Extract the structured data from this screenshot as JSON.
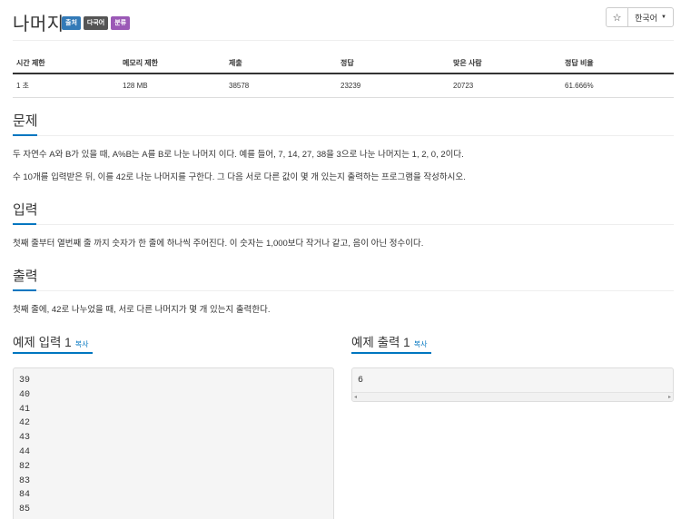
{
  "header": {
    "title": "나머지",
    "labels": [
      "출처",
      "다국어",
      "분류"
    ],
    "star_icon": "star-icon",
    "lang_label": "한국어"
  },
  "stats": {
    "headers": [
      "시간 제한",
      "메모리 제한",
      "제출",
      "정답",
      "맞은 사람",
      "정답 비율"
    ],
    "values": [
      "1 초",
      "128 MB",
      "38578",
      "23239",
      "20723",
      "61.666%"
    ]
  },
  "problem": {
    "heading": "문제",
    "p1": "두 자연수 A와 B가 있을 때, A%B는 A를 B로 나눈 나머지 이다. 예를 들어, 7, 14, 27, 38을 3으로 나눈 나머지는 1, 2, 0, 2이다.",
    "p2": "수 10개를 입력받은 뒤, 이를 42로 나눈 나머지를 구한다. 그 다음 서로 다른 값이 몇 개 있는지 출력하는 프로그램을 작성하시오."
  },
  "input": {
    "heading": "입력",
    "text": "첫째 줄부터 열번째 줄 까지 숫자가 한 줄에 하나씩 주어진다. 이 숫자는 1,000보다 작거나 같고, 음이 아닌 정수이다."
  },
  "output": {
    "heading": "출력",
    "text": "첫째 줄에, 42로 나누었을 때, 서로 다른 나머지가 몇 개 있는지 출력한다."
  },
  "sample_input": {
    "heading": "예제 입력 1",
    "copy": "복사",
    "lines": [
      "39",
      "40",
      "41",
      "42",
      "43",
      "44",
      "82",
      "83",
      "84",
      "85"
    ]
  },
  "sample_output": {
    "heading": "예제 출력 1",
    "copy": "복사",
    "lines": [
      "6"
    ]
  },
  "colors": {
    "accent": "#0076c0",
    "label_blue": "#337ab7",
    "label_gray": "#555555",
    "label_purple": "#9b59b6"
  }
}
